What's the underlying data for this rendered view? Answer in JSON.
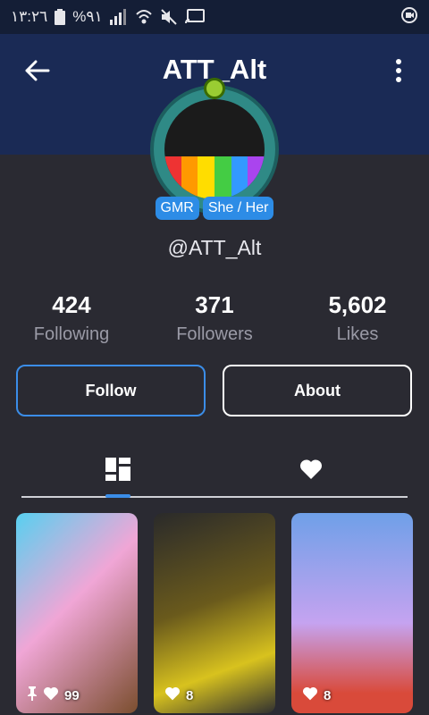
{
  "status_bar": {
    "time": "١٣:٢٦",
    "battery_percent": "%٩١",
    "icons": [
      "battery-icon",
      "signal-icon",
      "wifi-icon",
      "mute-icon",
      "cast-icon",
      "screen-record-icon"
    ]
  },
  "header": {
    "title": "ATT_Alt",
    "back_icon": "arrow-left-icon",
    "more_icon": "more-vert-icon"
  },
  "profile": {
    "tags": [
      "GMR",
      "She / Her"
    ],
    "handle": "@ATT_Alt"
  },
  "stats": [
    {
      "value": "424",
      "label": "Following"
    },
    {
      "value": "371",
      "label": "Followers"
    },
    {
      "value": "5,602",
      "label": "Likes"
    }
  ],
  "actions": {
    "follow": "Follow",
    "about": "About"
  },
  "tabs": [
    {
      "name": "posts",
      "icon": "grid-icon",
      "active": true
    },
    {
      "name": "likes",
      "icon": "heart-icon",
      "active": false
    }
  ],
  "posts": [
    {
      "pinned": true,
      "likes": "99"
    },
    {
      "pinned": false,
      "likes": "8"
    },
    {
      "pinned": false,
      "likes": "8"
    }
  ],
  "colors": {
    "background": "#2a2a32",
    "header": "#1a2a55",
    "accent": "#3b8de8",
    "tag": "#2d8ce6"
  }
}
